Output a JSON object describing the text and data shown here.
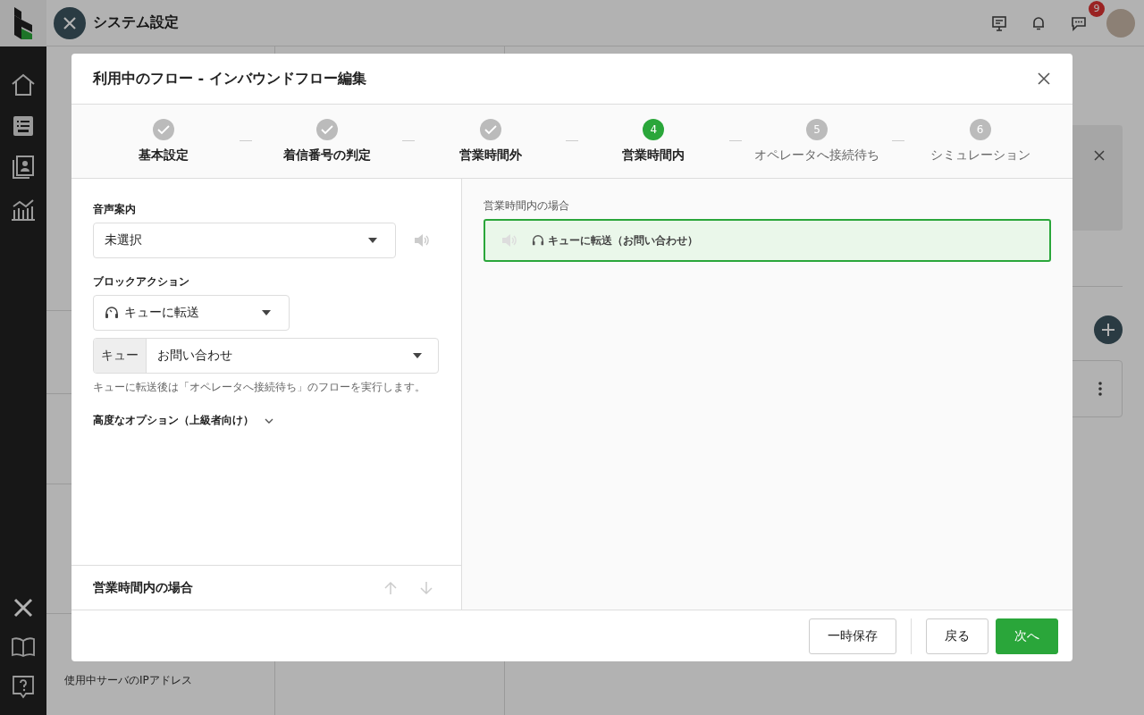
{
  "app_header": {
    "title": "システム設定",
    "notification_badge": "9"
  },
  "settings_menu": [
    {
      "label": "使用中サーバのIPアドレス"
    }
  ],
  "modal": {
    "title": "利用中のフロー - インバウンドフロー編集",
    "steps": [
      {
        "label": "基本設定",
        "kind": "done"
      },
      {
        "label": "着信番号の判定",
        "kind": "done"
      },
      {
        "label": "営業時間外",
        "kind": "done"
      },
      {
        "label": "営業時間内",
        "kind": "current",
        "number": "4"
      },
      {
        "label": "オペレータへ接続待ち",
        "kind": "todo",
        "number": "5"
      },
      {
        "label": "シミュレーション",
        "kind": "todo",
        "number": "6"
      }
    ],
    "voice_guidance": {
      "label": "音声案内",
      "value": "未選択"
    },
    "block_action": {
      "label": "ブロックアクション",
      "value": "キューに転送",
      "queue_label": "キュー",
      "queue_value": "お問い合わせ",
      "help": "キューに転送後は「オペレータへ接続待ち」のフローを実行します。"
    },
    "advanced_options": {
      "label": "高度なオプション（上級者向け）",
      "expanded": false
    },
    "section_footer": {
      "title": "営業時間内の場合"
    },
    "preview": {
      "label": "営業時間内の場合",
      "block": "キューに転送（お問い合わせ）",
      "selected": true
    },
    "buttons": [
      {
        "label": "一時保存",
        "kind": "secondary"
      },
      {
        "label": "戻る",
        "kind": "secondary"
      },
      {
        "label": "次へ",
        "kind": "primary"
      }
    ]
  }
}
